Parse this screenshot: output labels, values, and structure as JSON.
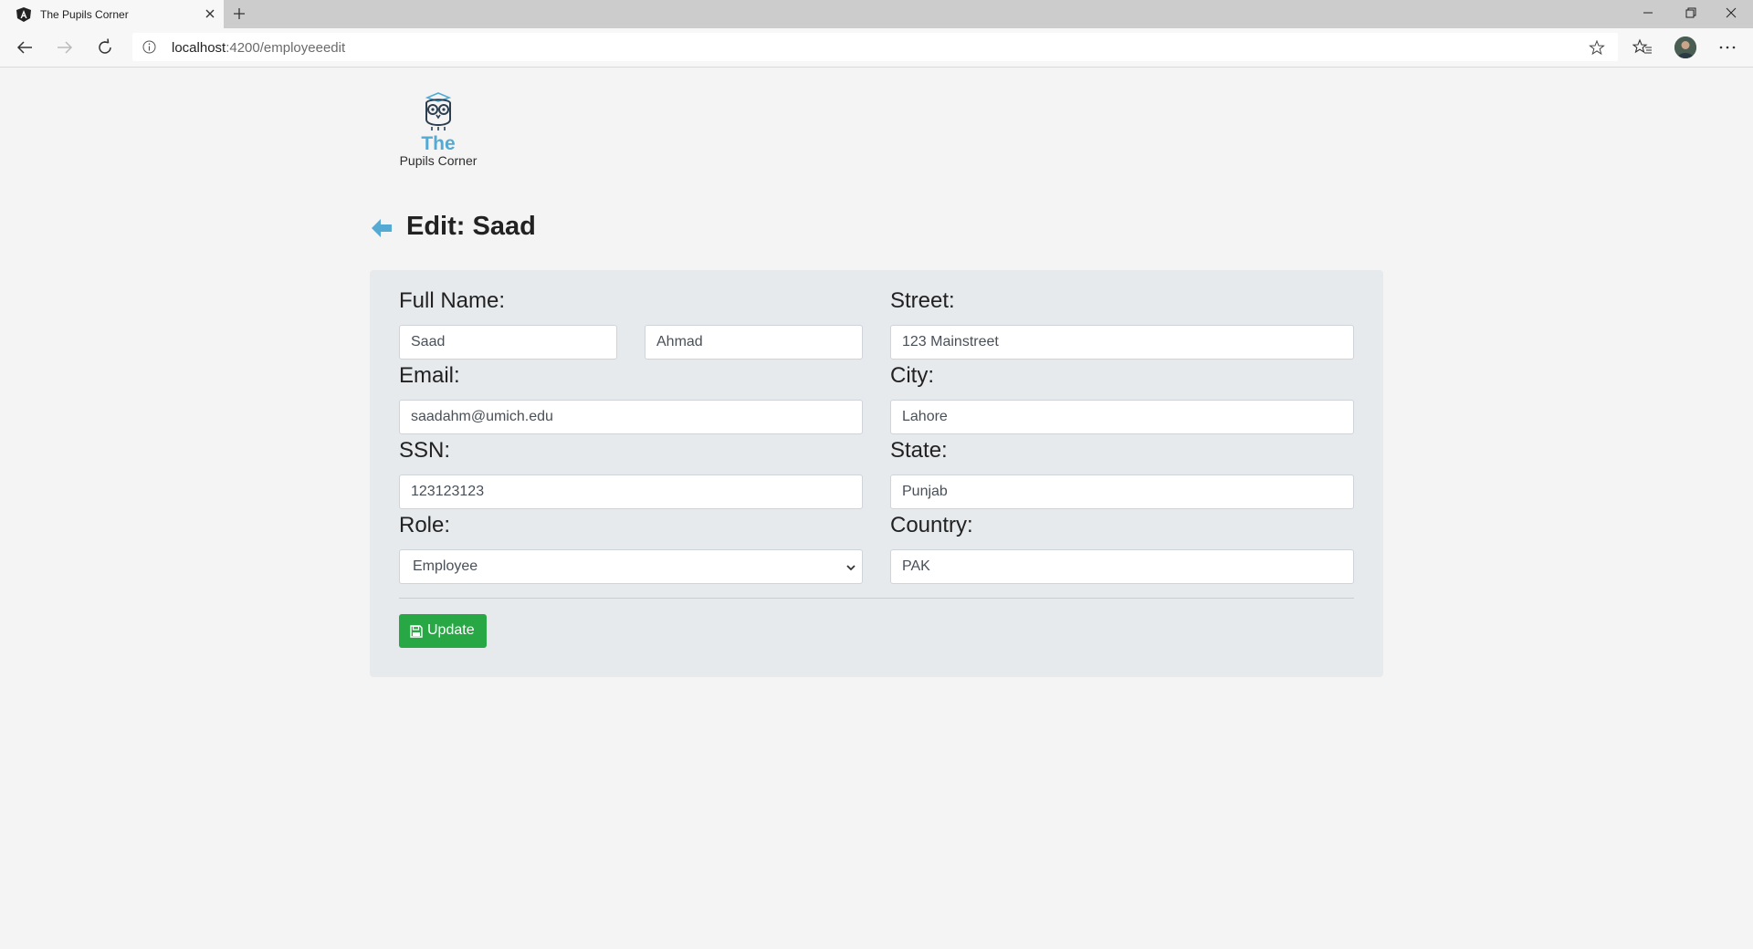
{
  "browser": {
    "tab_title": "The Pupils Corner",
    "url_host": "localhost",
    "url_path": ":4200/employeeedit"
  },
  "logo": {
    "line1": "The",
    "line2": "Pupils Corner"
  },
  "page": {
    "heading": "Edit: Saad"
  },
  "form": {
    "full_name_label": "Full Name:",
    "first_name_value": "Saad",
    "last_name_value": "Ahmad",
    "email_label": "Email:",
    "email_value": "saadahm@umich.edu",
    "ssn_label": "SSN:",
    "ssn_value": "123123123",
    "role_label": "Role:",
    "role_selected": "Employee",
    "street_label": "Street:",
    "street_value": "123 Mainstreet",
    "city_label": "City:",
    "city_value": "Lahore",
    "state_label": "State:",
    "state_value": "Punjab",
    "country_label": "Country:",
    "country_value": "PAK",
    "update_label": "Update"
  },
  "colors": {
    "accent_blue": "#55aad3",
    "update_green": "#28a745",
    "card_bg": "#e7eaed",
    "page_bg": "#f4f4f4"
  },
  "icons": [
    "angular-favicon",
    "close-icon",
    "plus-icon",
    "minimize-icon",
    "restore-icon",
    "window-close-icon",
    "back-icon",
    "forward-icon",
    "reload-icon",
    "info-icon",
    "star-icon",
    "favorites-icon",
    "more-icon",
    "owl-logo",
    "back-arrow-icon",
    "chevron-down-icon",
    "save-icon"
  ]
}
